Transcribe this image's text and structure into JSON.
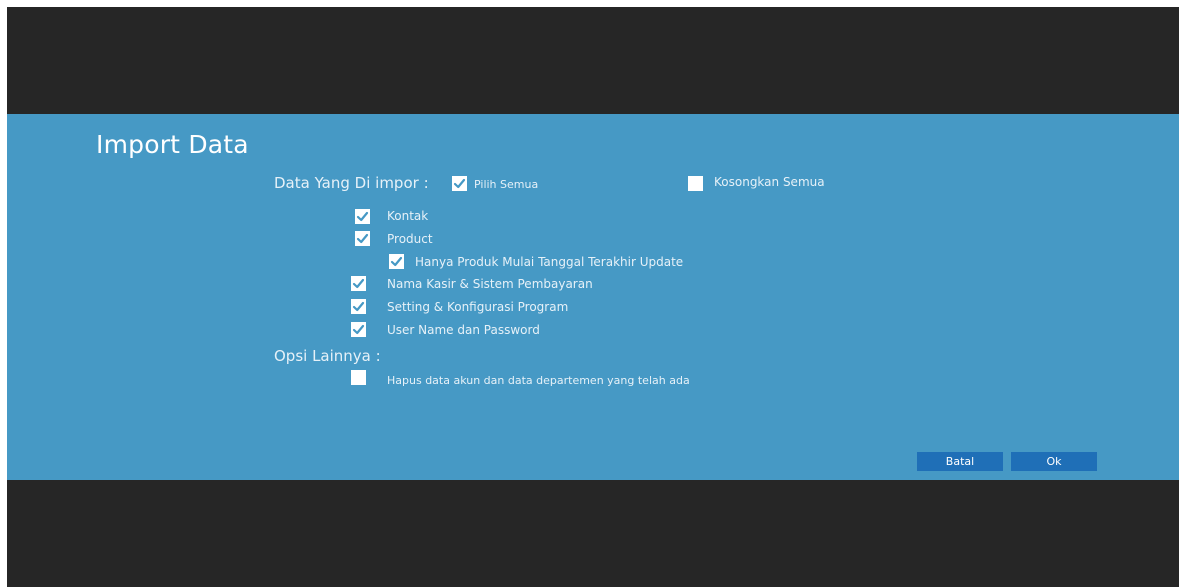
{
  "dialog": {
    "title": "Import Data",
    "data_section_label": "Data Yang Di impor :",
    "select_all": {
      "label": "Pilih Semua",
      "checked": true
    },
    "clear_all": {
      "label": "Kosongkan Semua",
      "checked": false
    },
    "items": [
      {
        "label": "Kontak",
        "checked": true
      },
      {
        "label": "Product",
        "checked": true
      },
      {
        "label": "Hanya Produk Mulai Tanggal Terakhir Update",
        "checked": true
      },
      {
        "label": "Nama Kasir & Sistem Pembayaran",
        "checked": true
      },
      {
        "label": "Setting & Konfigurasi Program",
        "checked": true
      },
      {
        "label": "User Name dan Password",
        "checked": true
      }
    ],
    "other_options_label": "Opsi Lainnya :",
    "other_options": [
      {
        "label": "Hapus data akun dan data departemen yang telah ada",
        "checked": false
      }
    ],
    "buttons": {
      "cancel": "Batal",
      "ok": "Ok"
    }
  },
  "colors": {
    "dialog_background": "#4699c5",
    "backdrop": "#262626",
    "button": "#1f6fb7",
    "checkmark": "#4699c5"
  },
  "icons": {
    "checkbox_checked": "checkmark-icon"
  }
}
